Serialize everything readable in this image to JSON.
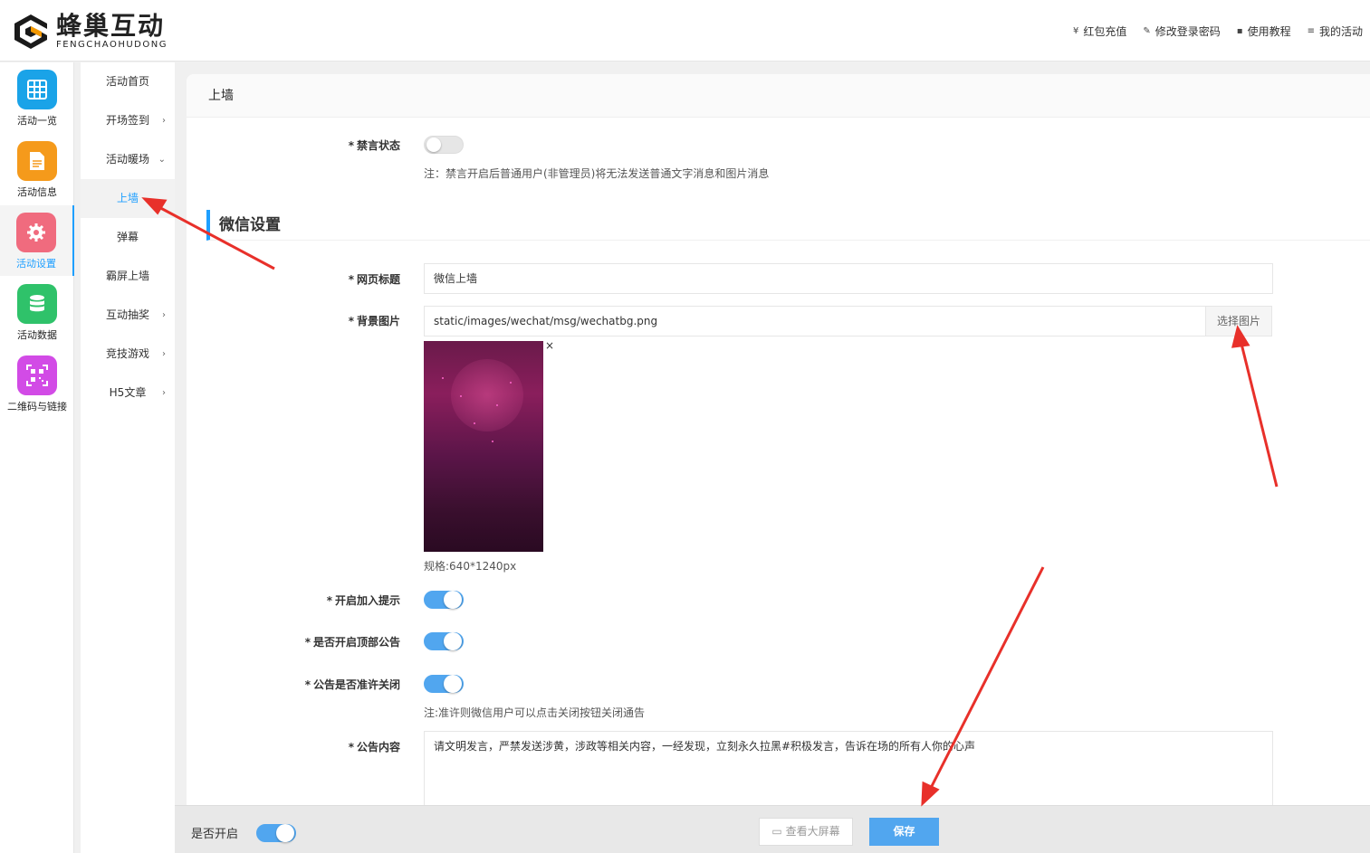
{
  "brand": {
    "name_cn": "蜂巢互动",
    "name_en": "FENGCHAOHUDONG"
  },
  "top_links": [
    {
      "icon": "¥",
      "label": "红包充值"
    },
    {
      "icon": "✎",
      "label": "修改登录密码"
    },
    {
      "icon": "▪",
      "label": "使用教程"
    },
    {
      "icon": "≡",
      "label": "我的活动"
    }
  ],
  "icon_sidebar": [
    {
      "label": "活动一览",
      "color": "#1aa3e8"
    },
    {
      "label": "活动信息",
      "color": "#f59a1b"
    },
    {
      "label": "活动设置",
      "color": "#f06b7e"
    },
    {
      "label": "活动数据",
      "color": "#2fc26a"
    },
    {
      "label": "二维码与链接",
      "color": "#d24be6"
    }
  ],
  "sub_nav": [
    {
      "label": "活动首页",
      "arrow": ""
    },
    {
      "label": "开场签到",
      "arrow": "›"
    },
    {
      "label": "活动暖场",
      "arrow": "⌄"
    },
    {
      "label": "上墙",
      "arrow": ""
    },
    {
      "label": "弹幕",
      "arrow": ""
    },
    {
      "label": "霸屏上墙",
      "arrow": ""
    },
    {
      "label": "互动抽奖",
      "arrow": "›"
    },
    {
      "label": "竞技游戏",
      "arrow": "›"
    },
    {
      "label": "H5文章",
      "arrow": "›"
    }
  ],
  "content": {
    "title": "上墙",
    "mute": {
      "label": "禁言状态",
      "on": false,
      "note": "注：禁言开启后普通用户(非管理员)将无法发送普通文字消息和图片消息"
    },
    "section_title": "微信设置",
    "page_title": {
      "label": "网页标题",
      "value": "微信上墙"
    },
    "bg_image": {
      "label": "背景图片",
      "value": "static/images/wechat/msg/wechatbg.png",
      "choose": "选择图片",
      "close": "×",
      "spec": "规格:640*1240px"
    },
    "join_tip": {
      "label": "开启加入提示",
      "on": true
    },
    "top_notice": {
      "label": "是否开启顶部公告",
      "on": true
    },
    "notice_close": {
      "label": "公告是否准许关闭",
      "on": true,
      "note": "注:准许则微信用户可以点击关闭按钮关闭通告"
    },
    "notice_content": {
      "label": "公告内容",
      "value": "请文明发言，严禁发送涉黄，涉政等相关内容，一经发现，立刻永久拉黑#积极发言，告诉在场的所有人你的心声"
    }
  },
  "bottom_bar": {
    "enable_label": "是否开启",
    "enabled": true,
    "screen_button": "查看大屏幕",
    "save_button": "保存"
  },
  "colors": {
    "accent": "#1e9fff",
    "switch_on": "#51a6ef",
    "arrow": "#e8302a"
  }
}
